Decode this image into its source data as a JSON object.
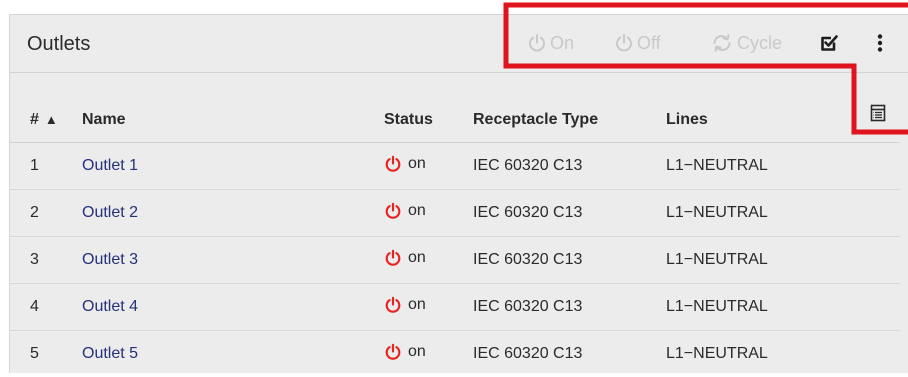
{
  "panel": {
    "title": "Outlets"
  },
  "toolbar": {
    "on_label": "On",
    "off_label": "Off",
    "cycle_label": "Cycle",
    "on_icon": "power-icon",
    "off_icon": "power-icon",
    "cycle_icon": "refresh-icon",
    "select_icon": "checkbox-checked-icon",
    "more_icon": "more-vertical-icon",
    "columns_icon": "columns-icon"
  },
  "table": {
    "columns": {
      "num": "#",
      "num_sort": "▲",
      "name": "Name",
      "status": "Status",
      "receptacle": "Receptacle Type",
      "lines": "Lines"
    },
    "rows": [
      {
        "num": "1",
        "name": "Outlet 1",
        "status": "on",
        "receptacle": "IEC 60320 C13",
        "lines": "L1−NEUTRAL"
      },
      {
        "num": "2",
        "name": "Outlet 2",
        "status": "on",
        "receptacle": "IEC 60320 C13",
        "lines": "L1−NEUTRAL"
      },
      {
        "num": "3",
        "name": "Outlet 3",
        "status": "on",
        "receptacle": "IEC 60320 C13",
        "lines": "L1−NEUTRAL"
      },
      {
        "num": "4",
        "name": "Outlet 4",
        "status": "on",
        "receptacle": "IEC 60320 C13",
        "lines": "L1−NEUTRAL"
      },
      {
        "num": "5",
        "name": "Outlet 5",
        "status": "on",
        "receptacle": "IEC 60320 C13",
        "lines": "L1−NEUTRAL"
      }
    ]
  },
  "colors": {
    "power_on": "#e8231f",
    "highlight": "#e0141e",
    "disabled": "#c9c9c9",
    "link": "#25317a"
  }
}
